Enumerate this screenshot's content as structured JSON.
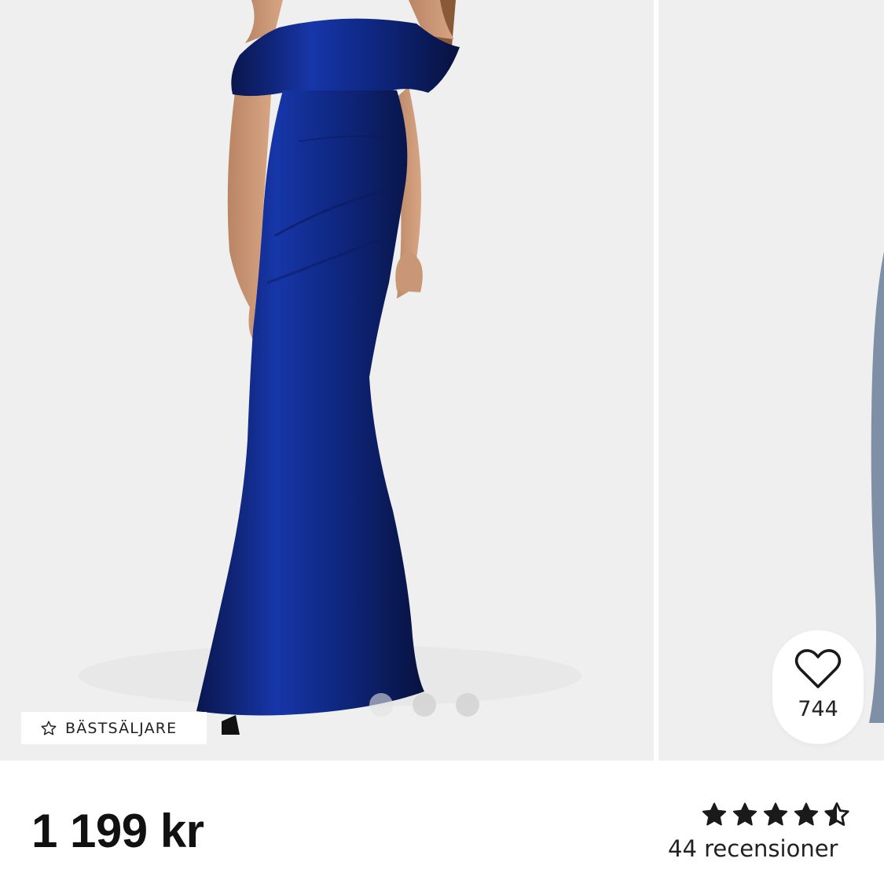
{
  "product": {
    "badge": {
      "icon": "star-outline-icon",
      "label": "BÄSTSÄLJARE"
    },
    "wishlist": {
      "icon": "heart-outline-icon",
      "count": "744"
    },
    "price": "1 199 kr",
    "rating": {
      "value": 4.5,
      "max": 5,
      "icon": "star-icon",
      "reviews_label": "44 recensioner"
    },
    "gallery": {
      "slides_total": 4,
      "active_slide": 1
    },
    "image": {
      "dress_color": "#0d1f6e",
      "background_color": "#efefef"
    }
  }
}
